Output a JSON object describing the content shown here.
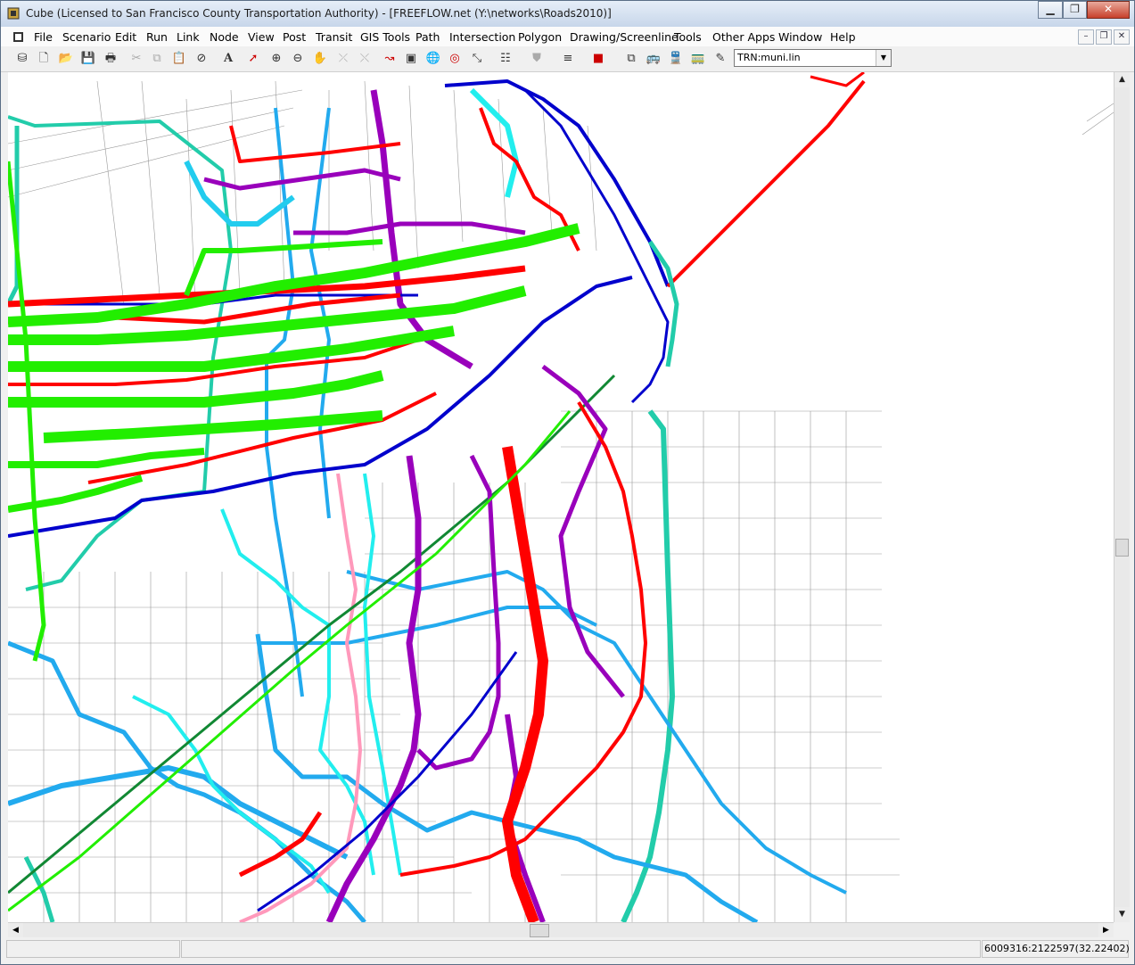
{
  "window": {
    "title": "Cube (Licensed to San Francisco County Transportation Authority) - [FREEFLOW.net (Y:\\networks\\Roads2010)]",
    "controls": {
      "minimize": "▁",
      "maximize": "❐",
      "close": "✕"
    }
  },
  "menubar": {
    "items": [
      "File",
      "Scenario",
      "Edit",
      "Run",
      "Link",
      "Node",
      "View",
      "Post",
      "Transit",
      "GIS Tools",
      "Path",
      "Intersection",
      "Polygon",
      "Drawing/Screenline",
      "Tools",
      "Other Apps",
      "Window",
      "Help"
    ],
    "mdi_controls": {
      "minimize": "–",
      "restore": "❐",
      "close": "✕"
    }
  },
  "toolbar": {
    "icons": [
      "database-icon",
      "new-icon",
      "open-icon",
      "save-icon",
      "print-icon",
      "cut-icon",
      "copy-icon",
      "paste-icon",
      "cancel-icon",
      "text-icon",
      "pointer-icon",
      "zoom-in-icon",
      "zoom-out-icon",
      "pan-icon",
      "select-nodes-icon",
      "select-links-icon",
      "draw-link-icon",
      "layers-icon",
      "globe-icon",
      "target-icon",
      "scale-icon",
      "table-icon",
      "filter-icon",
      "line-style-icon",
      "color-icon",
      "transit-icon",
      "bus-icon",
      "train-icon",
      "rail-icon",
      "edit-icon"
    ],
    "transit_file": "TRN:muni.lin"
  },
  "map": {
    "route_colors": {
      "red": "#ff0000",
      "green": "#22ee00",
      "blue": "#0000cc",
      "purple": "#9900bb",
      "cyan": "#22ccee",
      "light_blue": "#22aaee",
      "teal": "#22ccaa",
      "pink": "#ff99bb",
      "dark_green": "#118833",
      "gray": "#999999"
    }
  },
  "statusbar": {
    "coordinates": "6009316:2122597(32.22402)"
  }
}
